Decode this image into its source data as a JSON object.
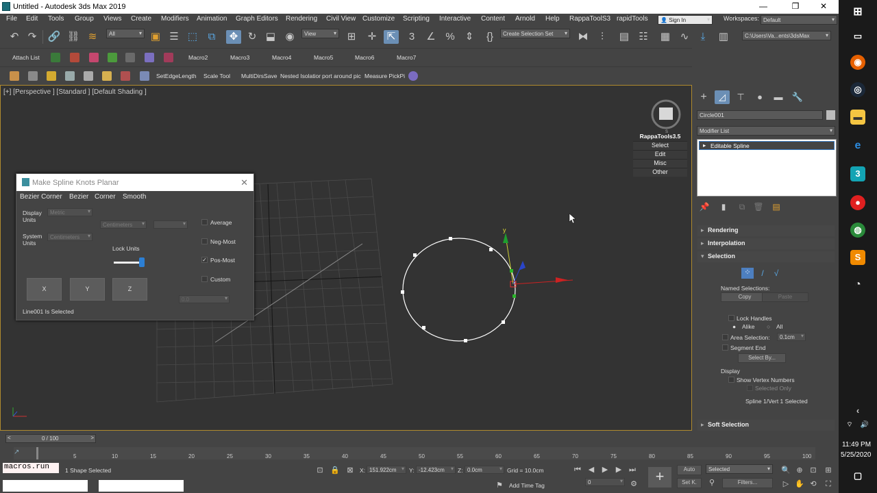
{
  "title_bar": {
    "title": "Untitled - Autodesk 3ds Max 2019"
  },
  "menu": [
    "File",
    "Edit",
    "Tools",
    "Group",
    "Views",
    "Create",
    "Modifiers",
    "Animation",
    "Graph Editors",
    "Rendering",
    "Civil View",
    "Customize",
    "Scripting",
    "Interactive",
    "Content",
    "Arnold",
    "Help",
    "RappaToolS3",
    "rapidTools"
  ],
  "sign_in": "Sign In",
  "workspaces": {
    "label": "Workspaces:",
    "value": "Default"
  },
  "toolbar": {
    "filter": "All",
    "view": "View",
    "selection_set": "Create Selection Set",
    "path": "C:\\Users\\Va...ents\\3dsMax"
  },
  "macros": {
    "attach": "Attach List",
    "items": [
      "Macro2",
      "Macro3",
      "Macro4",
      "Macro5",
      "Macro6",
      "Macro7"
    ]
  },
  "tools3": [
    "SetEdgeLength",
    "Scale Tool",
    "MultiDirsSave",
    "Nested Isolatior",
    "port around pic",
    "Measure PickPi"
  ],
  "viewport": {
    "label": "[+] [Perspective ] [Standard ] [Default Shading ]",
    "axis_y": "y"
  },
  "rappa": {
    "title": "RappaTools3.5",
    "items": [
      "Select",
      "Edit",
      "Misc",
      "Other"
    ]
  },
  "dialog": {
    "title": "Make Spline Knots Planar",
    "tabs": [
      "Bezier Corner",
      "Bezier",
      "Corner",
      "Smooth"
    ],
    "display_units_label": "Display Units",
    "display_units_value": "Metric",
    "display_sub": "Centimeters",
    "system_units_label": "System Units",
    "system_units_value": "Centimeters",
    "lock_units": "Lock Units",
    "options": [
      {
        "label": "Average",
        "checked": false
      },
      {
        "label": "Neg-Most",
        "checked": false
      },
      {
        "label": "Pos-Most",
        "checked": true
      },
      {
        "label": "Custom",
        "checked": false
      }
    ],
    "custom_value": "0.0",
    "buttons": [
      "X",
      "Y",
      "Z"
    ],
    "status": "Line001 Is Selected"
  },
  "command_panel": {
    "object_name": "Circle001",
    "modifier_list": "Modifier List",
    "stack_item": "Editable Spline",
    "rollouts": {
      "rendering": "Rendering",
      "interpolation": "Interpolation",
      "selection": "Selection",
      "soft_selection": "Soft Selection"
    },
    "named_selections": "Named Selections:",
    "copy": "Copy",
    "paste": "Paste",
    "lock_handles": "Lock Handles",
    "alike": "Alike",
    "all": "All",
    "area_selection": "Area Selection:",
    "area_value": "0.1cm",
    "segment_end": "Segment End",
    "select_by": "Select By...",
    "display": "Display",
    "show_vertex_numbers": "Show Vertex Numbers",
    "selected_only": "Selected Only",
    "status": "Spline 1/Vert 1 Selected"
  },
  "timeline": {
    "frame": "0 / 100",
    "ticks": [
      "5",
      "10",
      "15",
      "20",
      "25",
      "30",
      "35",
      "40",
      "45",
      "50",
      "55",
      "60",
      "65",
      "70",
      "75",
      "80",
      "85",
      "90",
      "95",
      "100"
    ]
  },
  "status_bar": {
    "script": "macros.run",
    "shape_selected": "1 Shape Selected",
    "x_label": "X:",
    "x": "151.922cm",
    "y_label": "Y:",
    "y": "-12.423cm",
    "z_label": "Z:",
    "z": "0.0cm",
    "grid": "Grid = 10.0cm",
    "add_time_tag": "Add Time Tag",
    "auto": "Auto",
    "selected": "Selected",
    "set_key": "Set K.",
    "filters": "Filters...",
    "frame_value": "0"
  },
  "windows_taskbar": {
    "time": "11:49 PM",
    "date": "5/25/2020"
  }
}
